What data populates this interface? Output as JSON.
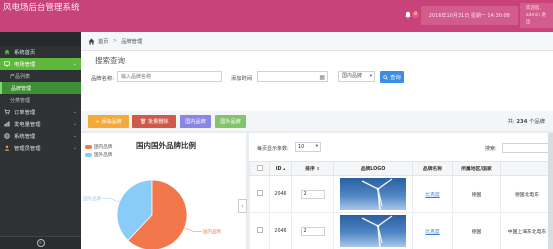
{
  "header": {
    "app_title": "风电场后台管理系统",
    "notification_count": "8",
    "datetime": "2016年10月31日 星期一 14:30:08",
    "user_line1": "欢迎您,",
    "user_line2": "admin  退出"
  },
  "sidebar": {
    "items": [
      {
        "label": "系统首页",
        "icon": "home-icon"
      },
      {
        "label": "电场管理",
        "icon": "monitor-icon"
      },
      {
        "label": "产品列表"
      },
      {
        "label": "品牌管理"
      },
      {
        "label": "分类管理"
      },
      {
        "label": "订单管理",
        "icon": "cart-icon"
      },
      {
        "label": "发电量管理",
        "icon": "chart-icon"
      },
      {
        "label": "系统管理",
        "icon": "gear-icon"
      },
      {
        "label": "管理员管理",
        "icon": "users-icon"
      }
    ]
  },
  "breadcrumb": {
    "home": "首页",
    "current": "品牌管理"
  },
  "search": {
    "title": "搜索查询",
    "brand_label": "品牌名称:",
    "brand_placeholder": "输入品牌名称",
    "date_label": "添加时间",
    "region_select": "国内品牌",
    "search_button": "查询"
  },
  "actions": {
    "add": "+ 添加品牌",
    "delete": "批量删除",
    "domestic": "国内品牌",
    "foreign": "国外品牌",
    "count_prefix": "共:",
    "count_value": "234",
    "count_suffix": "个品牌"
  },
  "legend": {
    "domestic": "国内品牌",
    "foreign": "国外品牌"
  },
  "colors": {
    "domestic": "#f2774a",
    "foreign": "#88ccf7"
  },
  "chart_data": {
    "type": "pie",
    "title": "国内国外品牌比例",
    "categories": [
      "国内品牌",
      "国外品牌"
    ],
    "values": [
      62,
      38
    ],
    "legend_position": "top-left",
    "slice_labels": [
      "国内品牌",
      "国外品牌"
    ]
  },
  "table": {
    "length_label_prefix": "每页显示条数:",
    "length_value": "10",
    "search_label": "搜索:",
    "columns": [
      "",
      "ID",
      "排序",
      "品牌LOGO",
      "品牌名称",
      "所属地区/国家",
      ""
    ],
    "rows": [
      {
        "id": "2046",
        "sort": "2",
        "name": "比克度",
        "region": "德国",
        "desc": "德国北电东"
      },
      {
        "id": "2046",
        "sort": "2",
        "name": "比克度",
        "region": "德国",
        "desc": "中国上海东北电东"
      }
    ]
  }
}
